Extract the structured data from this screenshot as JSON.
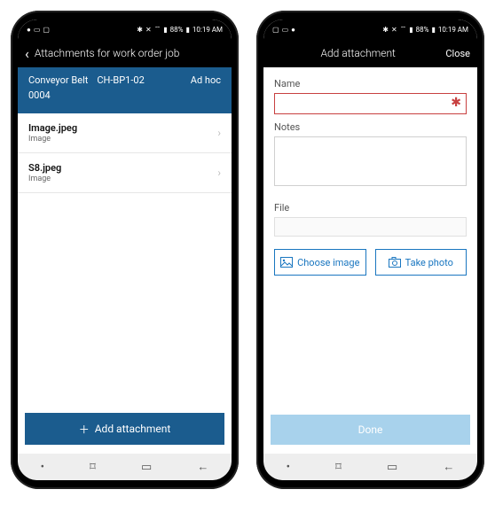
{
  "status": {
    "battery": "88%",
    "time": "10:19 AM"
  },
  "left": {
    "header_title": "Attachments for work order job",
    "blue": {
      "c1a": "Conveyor Belt",
      "c1b": "0004",
      "c2": "CH-BP1-02",
      "c3": "Ad hoc"
    },
    "rows": [
      {
        "name": "Image.jpeg",
        "sub": "Image"
      },
      {
        "name": "S8.jpeg",
        "sub": "Image"
      }
    ],
    "add_label": "Add attachment"
  },
  "right": {
    "header_title": "Add attachment",
    "close_label": "Close",
    "form": {
      "name_label": "Name",
      "notes_label": "Notes",
      "file_label": "File",
      "choose_image": "Choose image",
      "take_photo": "Take photo"
    },
    "done_label": "Done"
  }
}
